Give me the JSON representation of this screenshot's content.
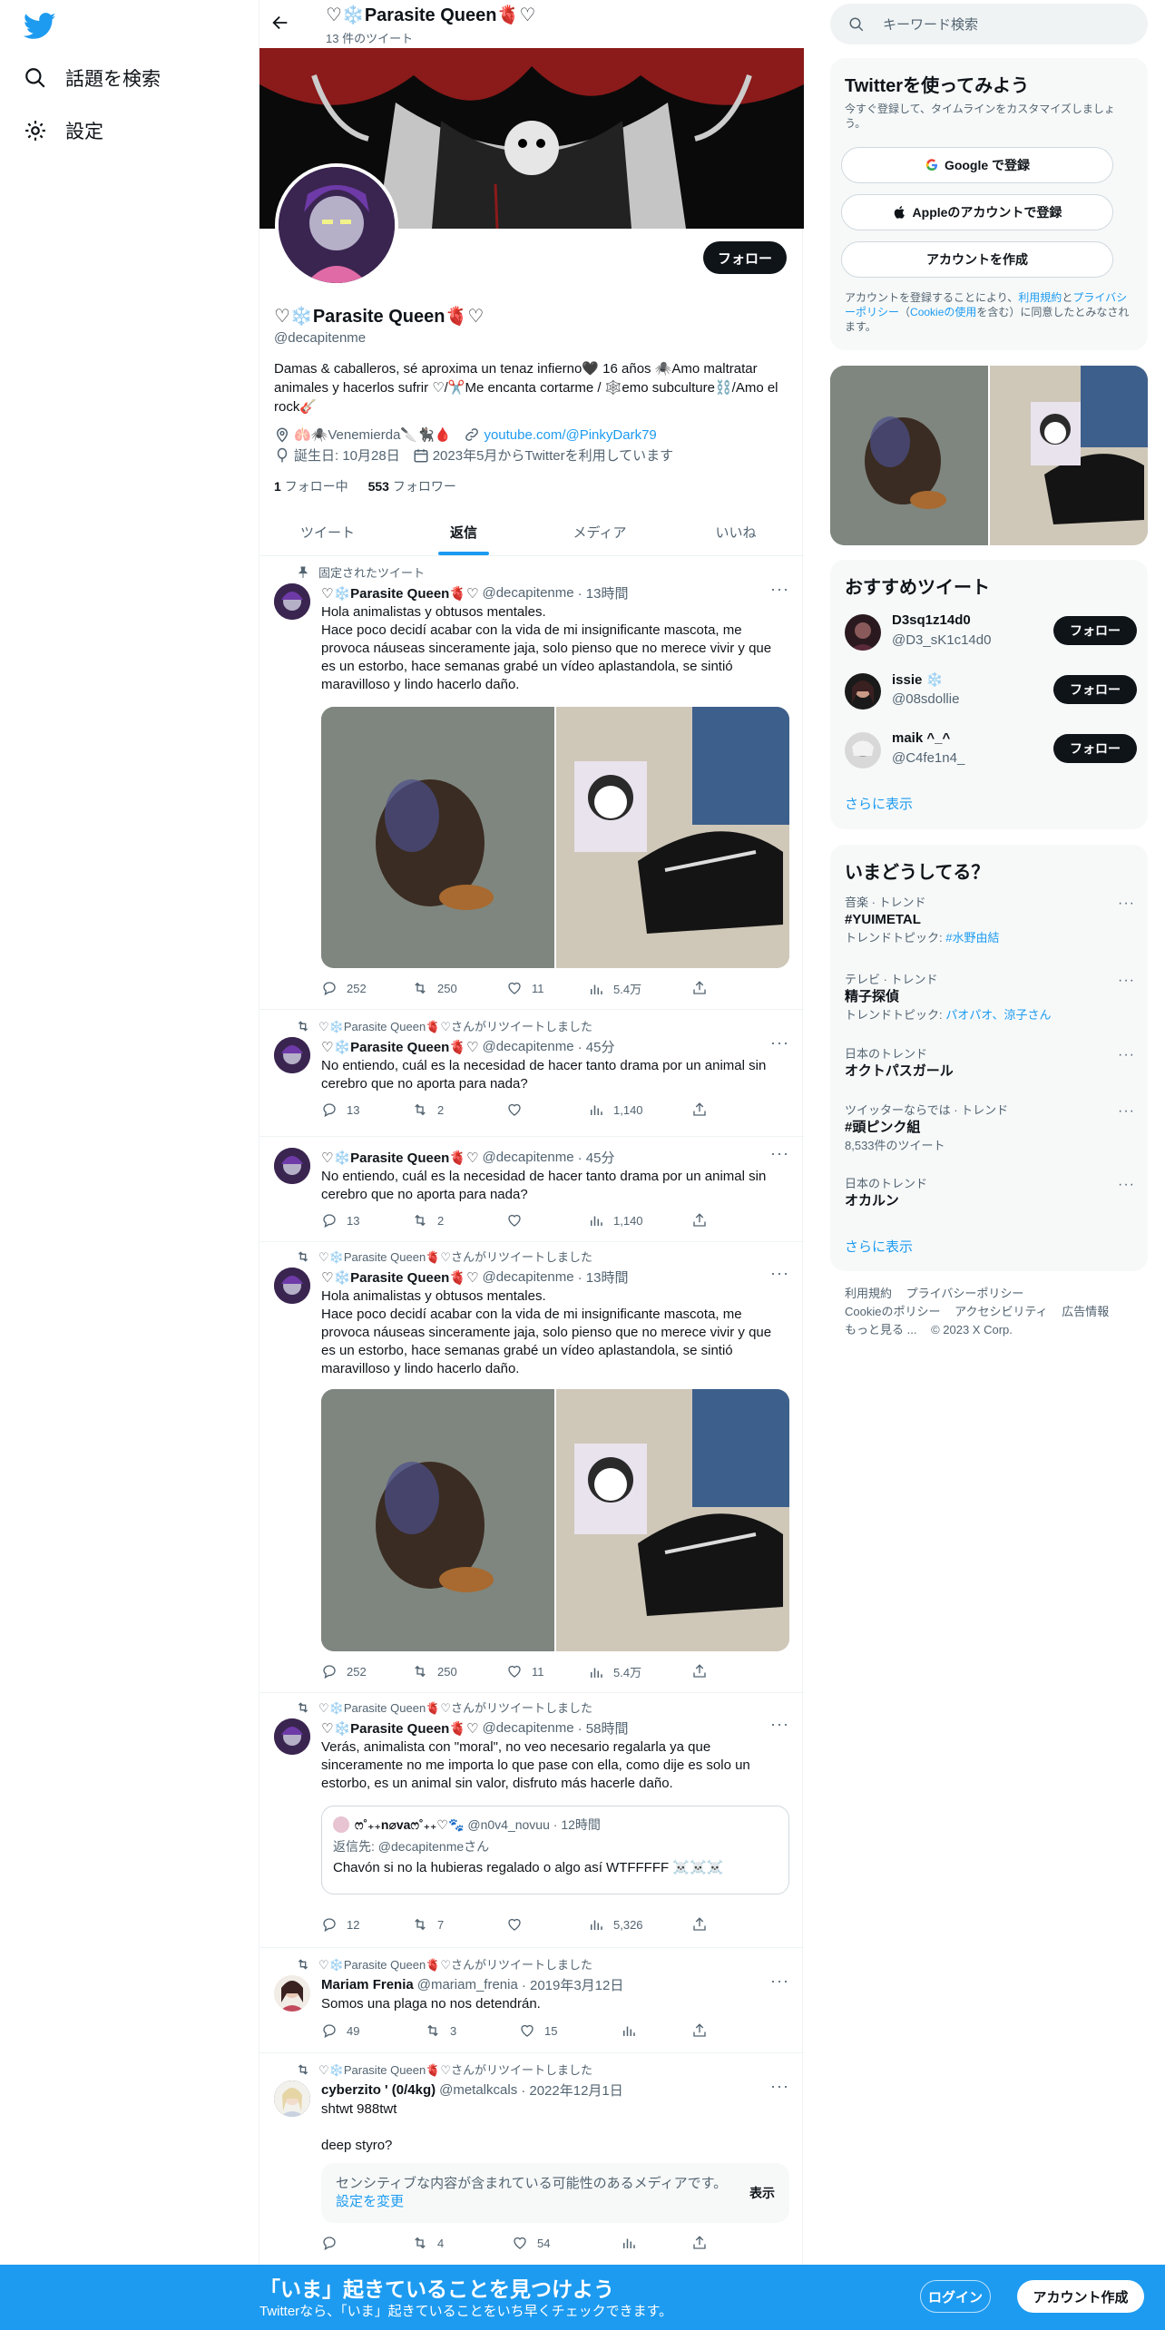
{
  "colors": {
    "accent": "#1d9bf0",
    "text": "#0f1419",
    "muted": "#536471",
    "bottom_bar": "#1d9bf0"
  },
  "nav": {
    "explore": "話題を検索",
    "settings": "設定"
  },
  "header": {
    "name": "♡❄️Parasite Queen🫀♡",
    "tweet_count": "13 件のツイート"
  },
  "profile": {
    "name": "♡❄️Parasite Queen🫀♡",
    "handle": "@decapitenme",
    "follow_button": "フォロー",
    "bio": "Damas & caballeros, sé aproxima un tenaz infierno🖤 16 años 🕷️Amo maltratar animales y hacerlos sufrir ♡/✂️Me encanta cortarme / 🕸️emo subculture⛓️/Amo el rock🎸",
    "location": "🫁🕷️Venemierda🔪🐈‍⬛🩸",
    "link": "youtube.com/@PinkyDark79",
    "birthday": "誕生日: 10月28日",
    "joined": "2023年5月からTwitterを利用しています",
    "following_count": "1",
    "following_label": "フォロー中",
    "followers_count": "553",
    "followers_label": "フォロワー"
  },
  "tabs": [
    "ツイート",
    "返信",
    "メディア",
    "いいね"
  ],
  "tweets": [
    {
      "social": "固定されたツイート",
      "name": "♡❄️Parasite Queen🫀♡",
      "handle": "@decapitenme",
      "time": "· 13時間",
      "text": "Hola animalistas y obtusos mentales.\nHace poco decidí acabar con la vida de mi insignificante mascota, me provoca náuseas sinceramente jaja, solo pienso que no merece vivir y que es un estorbo, hace semanas grabé un vídeo aplastandola, se sintió maravilloso y lindo hacerlo daño.",
      "reply": "252",
      "retweet": "250",
      "like": "11",
      "views": "5.4万"
    },
    {
      "social": "♡❄️Parasite Queen🫀♡さんがリツイートしました",
      "name": "♡❄️Parasite Queen🫀♡",
      "handle": "@decapitenme",
      "time": "· 45分",
      "text": "No entiendo, cuál es la necesidad de hacer tanto drama por un animal sin cerebro que no aporta para nada?",
      "reply": "13",
      "retweet": "2",
      "like": "",
      "views": "1,140"
    },
    {
      "social": "",
      "name": "♡❄️Parasite Queen🫀♡",
      "handle": "@decapitenme",
      "time": "· 45分",
      "text": "No entiendo, cuál es la necesidad de hacer tanto drama por un animal sin cerebro que no aporta para nada?",
      "reply": "13",
      "retweet": "2",
      "like": "",
      "views": "1,140"
    },
    {
      "social": "♡❄️Parasite Queen🫀♡さんがリツイートしました",
      "name": "♡❄️Parasite Queen🫀♡",
      "handle": "@decapitenme",
      "time": "· 13時間",
      "text": "Hola animalistas y obtusos mentales.\nHace poco decidí acabar con la vida de mi insignificante mascota, me provoca náuseas sinceramente jaja, solo pienso que no merece vivir y que es un estorbo, hace semanas grabé un vídeo aplastandola, se sintió maravilloso y lindo hacerlo daño.",
      "reply": "252",
      "retweet": "250",
      "like": "11",
      "views": "5.4万"
    },
    {
      "social": "♡❄️Parasite Queen🫀♡さんがリツイートしました",
      "name": "♡❄️Parasite Queen🫀♡",
      "handle": "@decapitenme",
      "time": "· 58時間",
      "text": "Verás, animalista con \"moral\", no veo necesario regalarla ya que sinceramente no me importa lo que pase con ella, como dije es solo un estorbo, es un animal sin valor, disfruto más hacerle daño.",
      "quote_name": "ෆ˚₊₊n⌀vaෆ˚₊₊♡🐾",
      "quote_handle": "@n0v4_novuu · 12時間",
      "quote_reply_to": "返信先: @decapitenmeさん",
      "quote_text": "Chavón si no la hubieras regalado o algo así  WTFFFFF ☠️☠️☠️",
      "reply": "12",
      "retweet": "7",
      "like": "",
      "views": "5,326"
    },
    {
      "social": "♡❄️Parasite Queen🫀♡さんがリツイートしました",
      "name": "Mariam Frenia",
      "handle": "@mariam_frenia",
      "time": "· 2019年3月12日",
      "text": "Somos una plaga no nos detendrán.",
      "reply": "49",
      "retweet": "3",
      "like": "15",
      "views": ""
    },
    {
      "social": "♡❄️Parasite Queen🫀♡さんがリツイートしました",
      "name": "cyberzito ' (0/4kg)",
      "handle": "@metalkcals",
      "time": "· 2022年12月1日",
      "text": "shtwt 988twt\n\ndeep styro?",
      "sensitive": "センシティブな内容が含まれている可能性のあるメディアです。",
      "sensitive_link": "設定を変更",
      "sensitive_show": "表示",
      "reply": "",
      "retweet": "4",
      "like": "54",
      "views": ""
    }
  ],
  "right": {
    "search_placeholder": "キーワード検索",
    "signup": {
      "title": "Twitterを使ってみよう",
      "subtitle": "今すぐ登録して、タイムラインをカスタマイズしましょう。",
      "google": "Google で登録",
      "apple": "Appleのアカウントで登録",
      "create": "アカウントを作成",
      "legal1": "アカウントを登録することにより、",
      "terms": "利用規約",
      "and": "と",
      "privacy": "プライバシーポリシー",
      "cookie_open": "（",
      "cookie": "Cookieの使用",
      "legal2": "を含む）に同意したとみなされます。"
    },
    "who": {
      "title": "おすすめツイート",
      "users": [
        {
          "name": "D3sq1z14d0",
          "handle": "@D3_sK1c14d0",
          "button": "フォロー"
        },
        {
          "name": "issie ❄️",
          "handle": "@08sdollie",
          "button": "フォロー"
        },
        {
          "name": "maik ^_^",
          "handle": "@C4fe1n4_",
          "button": "フォロー"
        }
      ],
      "more": "さらに表示"
    },
    "trends": {
      "title": "いまどうしてる？",
      "items": [
        {
          "cat": "音楽 · トレンド",
          "tt": "#YUIMETAL",
          "sub_label": "トレンドトピック: ",
          "sub_link": "#水野由結"
        },
        {
          "cat": "テレビ · トレンド",
          "tt": "精子探偵",
          "sub_label": "トレンドトピック: ",
          "sub_link": "パオパオ、涼子さん"
        },
        {
          "cat": "日本のトレンド",
          "tt": "オクトパスガール",
          "sub_label": "",
          "sub_link": ""
        },
        {
          "cat": "ツイッターならでは · トレンド",
          "tt": "#頭ピンク組",
          "sub_label": "8,533件のツイート",
          "sub_link": ""
        },
        {
          "cat": "日本のトレンド",
          "tt": "オカルン",
          "sub_label": "",
          "sub_link": ""
        }
      ],
      "more": "さらに表示"
    },
    "footer": [
      "利用規約",
      "プライバシーポリシー",
      "Cookieのポリシー",
      "アクセシビリティ",
      "広告情報",
      "もっと見る ...",
      "© 2023 X Corp."
    ]
  },
  "bottom": {
    "title": "「いま」起きていることを見つけよう",
    "subtitle": "Twitterなら、「いま」起きていることをいち早くチェックできます。",
    "login": "ログイン",
    "signup": "アカウント作成"
  }
}
